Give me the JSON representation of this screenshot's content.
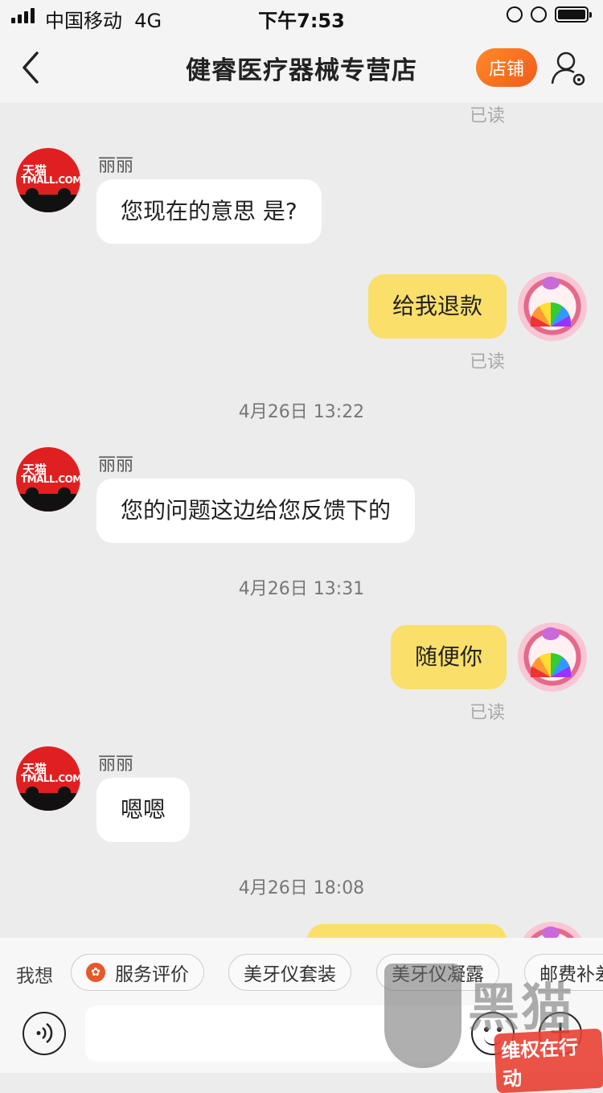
{
  "status_bar": {
    "carrier": "中国移动",
    "network": "4G",
    "time": "下午7:53"
  },
  "nav": {
    "title": "健睿医疗器械专营店",
    "shop_label": "店铺"
  },
  "messages": {
    "read_label": "已读",
    "sender_name": "丽丽",
    "m1": "您现在的意思 是?",
    "m2": "给我退款",
    "ts1": "4月26日 13:22",
    "m3": "您的问题这边给您反馈下的",
    "ts2": "4月26日 13:31",
    "m4": "随便你",
    "m5": "嗯嗯",
    "ts3": "4月26日 18:08"
  },
  "store_avatar": {
    "line1": "天猫",
    "line2": "TMALL.COM"
  },
  "quick_bar": {
    "label": "我想",
    "chips": [
      "服务评价",
      "美牙仪套装",
      "美牙仪凝露",
      "邮费补差"
    ]
  },
  "input": {
    "placeholder": ""
  },
  "watermark": {
    "chars": "黑猫",
    "tagline": "维权在行动"
  },
  "colors": {
    "accent_orange": "#f25b1a",
    "outgoing_bubble": "#fadf6a",
    "incoming_bubble": "#ffffff",
    "background": "#ececec"
  },
  "icons": [
    "back-chevron-icon",
    "profile-settings-icon",
    "voice-icon",
    "emoji-icon",
    "plus-icon",
    "service-rating-icon"
  ]
}
